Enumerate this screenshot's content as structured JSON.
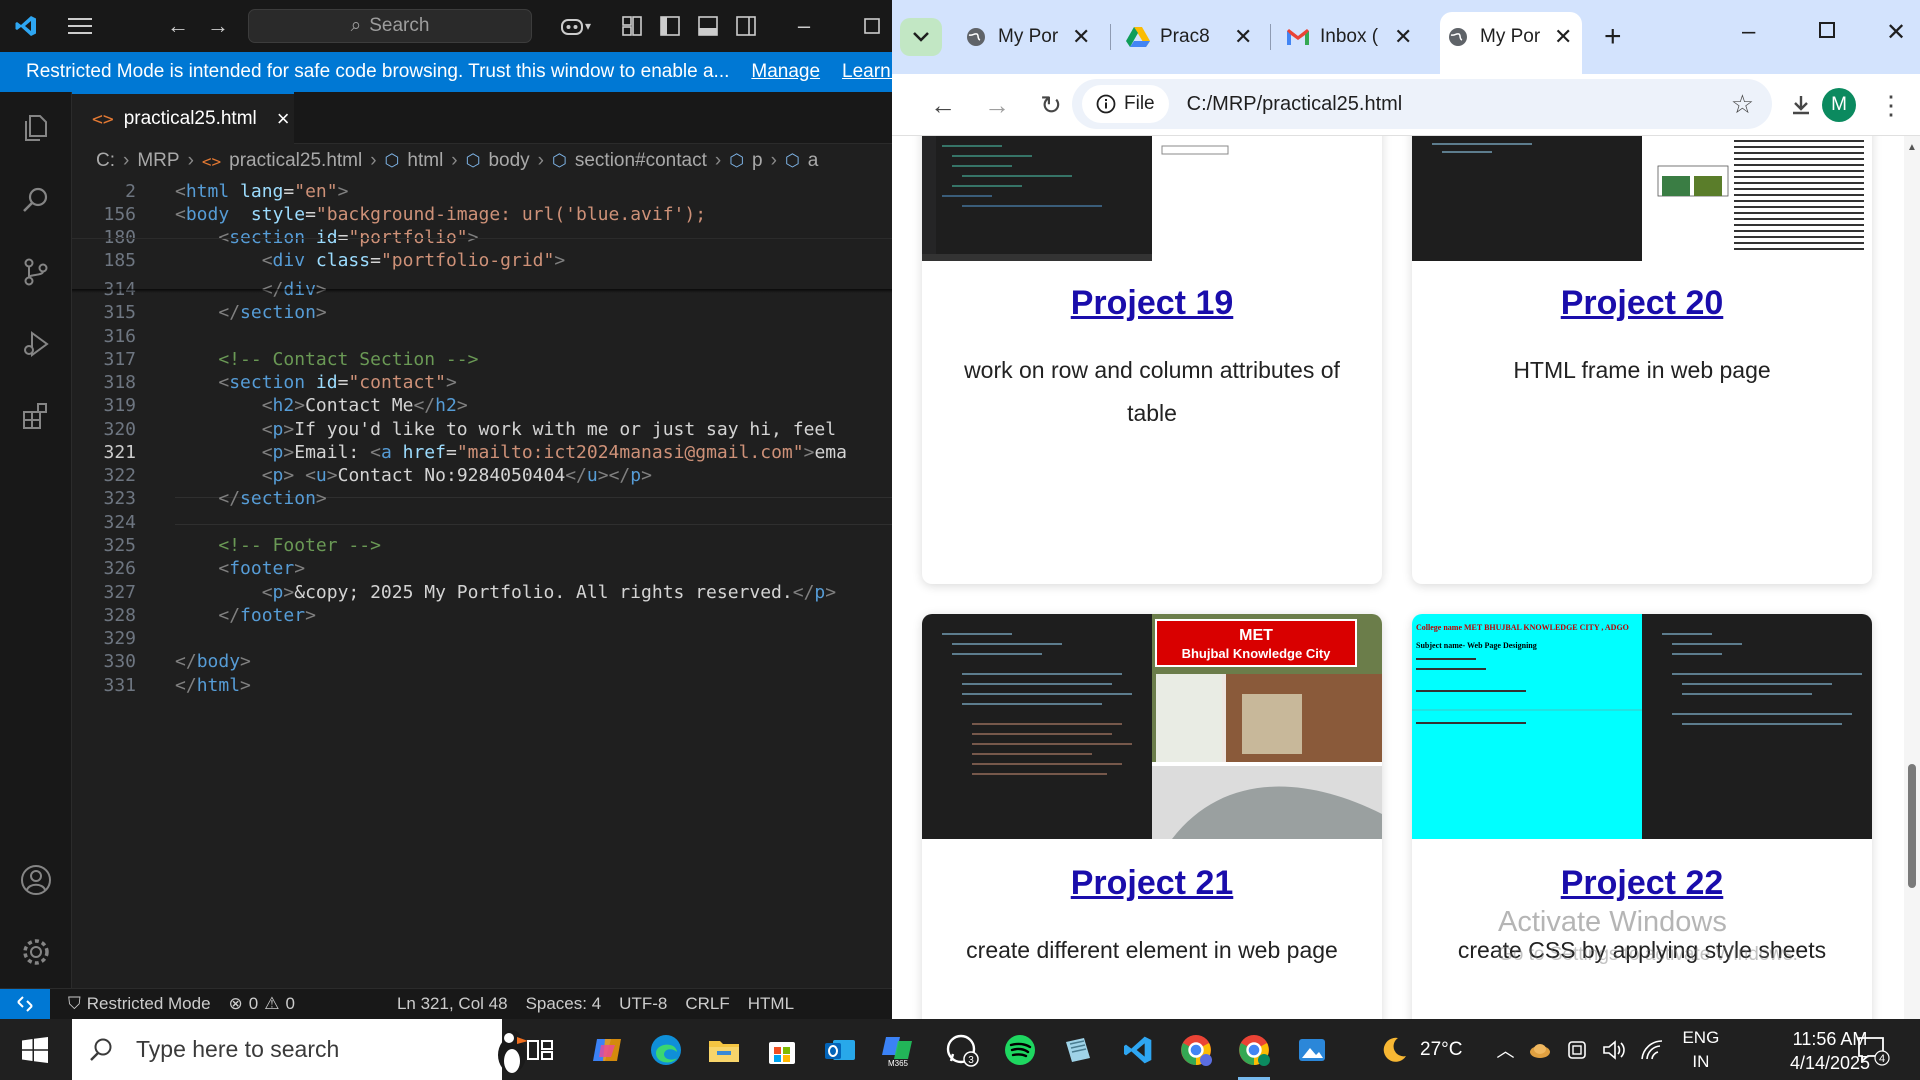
{
  "vscode": {
    "search_placeholder": "Search",
    "restricted_banner": {
      "text": "Restricted Mode is intended for safe code browsing. Trust this window to enable a...",
      "manage": "Manage",
      "learn": "Learn M"
    },
    "tab": {
      "label": "practical25.html"
    },
    "breadcrumb": [
      "C:",
      "MRP",
      "practical25.html",
      "html",
      "body",
      "section#contact",
      "p",
      "a"
    ],
    "lines": [
      {
        "n": "2",
        "code": "<html lang=\"en\">"
      },
      {
        "n": "156",
        "code": "<body  style=\"background-image: url('blue.avif');"
      },
      {
        "n": "180",
        "code": "    <section id=\"portfolio\">"
      },
      {
        "n": "185",
        "code": "        <div class=\"portfolio-grid\">"
      },
      {
        "n": "314",
        "code": "        </div>"
      },
      {
        "n": "315",
        "code": "    </section>"
      },
      {
        "n": "316",
        "code": ""
      },
      {
        "n": "317",
        "code": "    <!-- Contact Section -->"
      },
      {
        "n": "318",
        "code": "    <section id=\"contact\">"
      },
      {
        "n": "319",
        "code": "        <h2>Contact Me</h2>"
      },
      {
        "n": "320",
        "code": "        <p>If you'd like to work with me or just say hi, feel"
      },
      {
        "n": "321",
        "code": "        <p>Email: <a href=\"mailto:ict2024manasi@gmail.com\">ema"
      },
      {
        "n": "322",
        "code": "        <p> <u>Contact No:9284050404</u></p>"
      },
      {
        "n": "323",
        "code": "    </section>"
      },
      {
        "n": "324",
        "code": ""
      },
      {
        "n": "325",
        "code": "    <!-- Footer -->"
      },
      {
        "n": "326",
        "code": "    <footer>"
      },
      {
        "n": "327",
        "code": "        <p>&copy; 2025 My Portfolio. All rights reserved.</p>"
      },
      {
        "n": "328",
        "code": "    </footer>"
      },
      {
        "n": "329",
        "code": ""
      },
      {
        "n": "330",
        "code": "</body>"
      },
      {
        "n": "331",
        "code": "</html>"
      }
    ],
    "current_line": "321",
    "status": {
      "mode": "Restricted Mode",
      "errors": "0",
      "warnings": "0",
      "position": "Ln 321, Col 48",
      "spaces": "Spaces: 4",
      "encoding": "UTF-8",
      "eol": "CRLF",
      "language": "HTML"
    }
  },
  "chrome": {
    "tabs": [
      {
        "title": "My Por",
        "icon": "globe-icon"
      },
      {
        "title": "Prac8",
        "icon": "google-drive-icon"
      },
      {
        "title": "Inbox (",
        "icon": "gmail-icon"
      },
      {
        "title": "My Por",
        "icon": "globe-icon",
        "active": true
      }
    ],
    "omnibox": {
      "chip": "File",
      "url": "C:/MRP/practical25.html"
    },
    "avatar": "M",
    "cards": [
      {
        "title": "Project 19",
        "desc": "work on row and column attributes of table"
      },
      {
        "title": "Project 20",
        "desc": "HTML frame in web page"
      },
      {
        "title": "Project 21",
        "desc": "create different element in web page"
      },
      {
        "title": "Project 22",
        "desc": "create CSS by applying style sheets"
      }
    ],
    "thumb_text": {
      "met_title": "MET",
      "met_subtitle": "Bhujbal Knowledge City",
      "college_line": "College name  MET BHUJBAL KNOWLEDGE CITY , ADGO",
      "subject_line": "Subject name- Web Page Designing"
    },
    "watermark": {
      "line1": "Activate Windows",
      "line2": "Go to Settings to activate Windows."
    }
  },
  "taskbar": {
    "search_placeholder": "Type here to search",
    "temperature": "27°C",
    "lang1": "ENG",
    "lang2": "IN",
    "time": "11:56 AM",
    "date": "4/14/2025",
    "notifications": "4",
    "whatsapp_badge": "3"
  }
}
